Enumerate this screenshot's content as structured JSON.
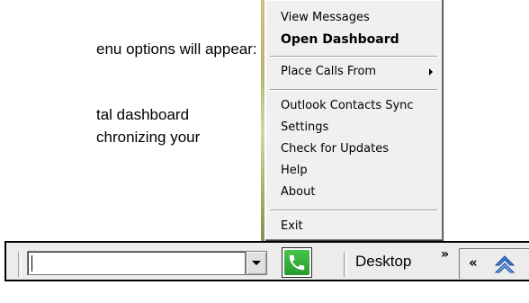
{
  "document": {
    "line1": "enu options will appear:",
    "line2": "tal dashboard",
    "line3": "chronizing your"
  },
  "context_menu": {
    "items": [
      {
        "label": "View Messages",
        "bold": false
      },
      {
        "label": "Open Dashboard",
        "bold": true
      },
      {
        "label": "Place Calls From",
        "submenu": true
      },
      {
        "label": "Outlook Contacts Sync"
      },
      {
        "label": "Settings"
      },
      {
        "label": "Check for Updates"
      },
      {
        "label": "Help"
      },
      {
        "label": "About"
      },
      {
        "label": "Exit"
      }
    ]
  },
  "taskbar": {
    "phone_input_value": "",
    "desktop_label": "Desktop",
    "expand_glyph": "»",
    "collapse_glyph": "«",
    "icons": {
      "call": "phone-icon",
      "dropdown": "chevron-down-icon",
      "tray": "up-chevron-icon"
    },
    "colors": {
      "call_green": "#2fae34",
      "tray_blue": "#3a7bd5"
    }
  }
}
